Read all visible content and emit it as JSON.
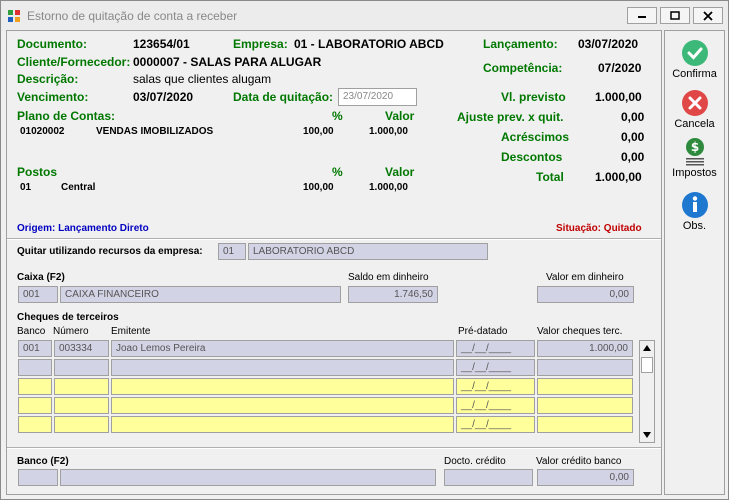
{
  "window": {
    "title": "Estorno de quitação de conta a receber"
  },
  "header": {
    "documento_label": "Documento:",
    "documento": "123654/01",
    "empresa_label": "Empresa:",
    "empresa": "01 - LABORATORIO ABCD",
    "lancamento_label": "Lançamento:",
    "lancamento": "03/07/2020",
    "cliente_label": "Cliente/Fornecedor:",
    "cliente": "0000007 - SALAS PARA ALUGAR",
    "competencia_label": "Competência:",
    "competencia": "07/2020",
    "descricao_label": "Descrição:",
    "descricao": "salas que clientes alugam",
    "vencimento_label": "Vencimento:",
    "vencimento": "03/07/2020",
    "data_quitacao_label": "Data de quitação:",
    "data_quitacao": "23/07/2020"
  },
  "plano": {
    "label": "Plano de Contas:",
    "pct_label": "%",
    "valor_label": "Valor",
    "code": "01020002",
    "name": "VENDAS IMOBILIZADOS",
    "pct": "100,00",
    "valor": "1.000,00"
  },
  "postos": {
    "label": "Postos",
    "pct_label": "%",
    "valor_label": "Valor",
    "code": "01",
    "name": "Central",
    "pct": "100,00",
    "valor": "1.000,00"
  },
  "summary": {
    "vl_previsto_label": "Vl. previsto",
    "vl_previsto": "1.000,00",
    "ajuste_label": "Ajuste prev. x quit.",
    "ajuste": "0,00",
    "acrescimos_label": "Acréscimos",
    "acrescimos": "0,00",
    "descontos_label": "Descontos",
    "descontos": "0,00",
    "total_label": "Total",
    "total": "1.000,00"
  },
  "origem": "Origem: Lançamento Direto",
  "situacao": "Situação: Quitado",
  "quitar": {
    "label": "Quitar utilizando recursos da empresa:",
    "code": "01",
    "name": "LABORATORIO ABCD"
  },
  "caixa": {
    "label": "Caixa (F2)",
    "code": "001",
    "name": "CAIXA FINANCEIRO",
    "saldo_label": "Saldo em dinheiro",
    "saldo": "1.746,50",
    "valor_label": "Valor em dinheiro",
    "valor": "0,00"
  },
  "cheques": {
    "label": "Cheques de terceiros",
    "col_banco": "Banco",
    "col_numero": "Número",
    "col_emitente": "Emitente",
    "col_predatado": "Pré-datado",
    "col_valor": "Valor cheques terc.",
    "rows": [
      {
        "banco": "001",
        "numero": "003334",
        "emitente": "Joao Lemos Pereira",
        "predatado": "__/__/____",
        "valor": "1.000,00"
      }
    ],
    "empty_date": "__/__/____"
  },
  "banco": {
    "label": "Banco (F2)",
    "docto_label": "Docto. crédito",
    "valor_label": "Valor crédito banco",
    "valor": "0,00"
  },
  "sidebar": {
    "confirma": "Confirma",
    "cancela": "Cancela",
    "impostos": "Impostos",
    "obs": "Obs."
  },
  "colors": {
    "green": "#007800",
    "blue": "#0000c0",
    "red": "#c00000",
    "field": "#d3d3e6",
    "yellow": "#ffff9c"
  }
}
